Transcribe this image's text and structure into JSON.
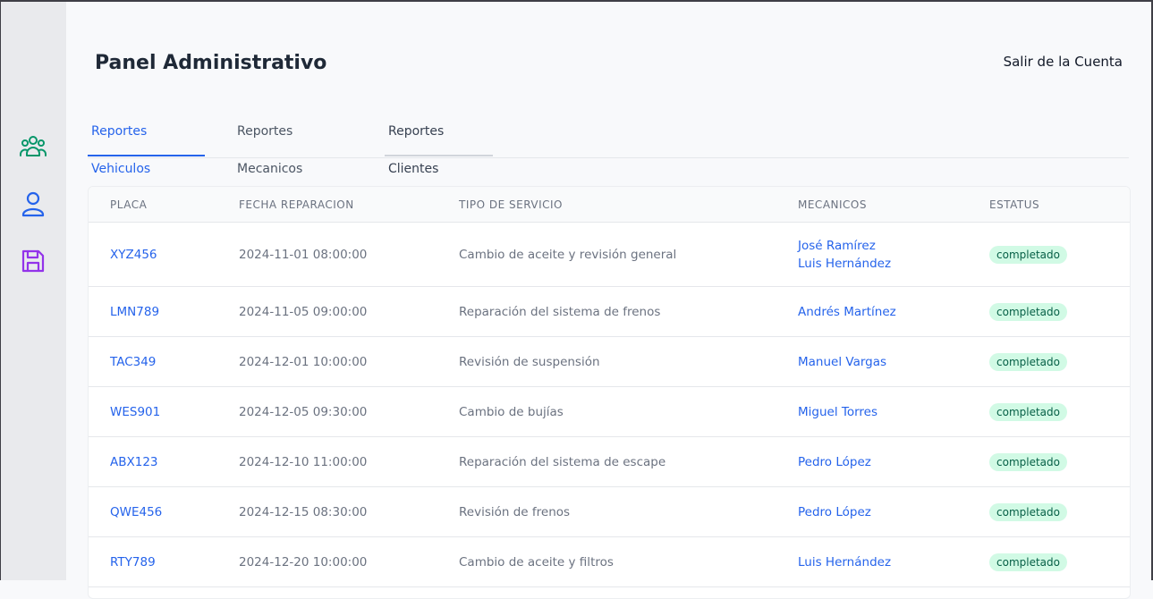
{
  "header": {
    "title": "Panel Administrativo",
    "logout_label": "Salir de la Cuenta"
  },
  "sidebar": {
    "icons": [
      "users-group-icon",
      "user-icon",
      "save-icon"
    ],
    "colors": {
      "users": "#059669",
      "user": "#2563eb",
      "save": "#9333ea"
    }
  },
  "tabs": [
    {
      "label": "Reportes Vehiculos",
      "active": true
    },
    {
      "label": "Reportes Mecanicos",
      "active": false
    },
    {
      "label": "Reportes Clientes",
      "active": false
    }
  ],
  "table": {
    "columns": [
      "PLACA",
      "FECHA REPARACION",
      "TIPO DE SERVICIO",
      "MECANICOS",
      "ESTATUS"
    ],
    "rows": [
      {
        "placa": "XYZ456",
        "fecha": "2024-11-01 08:00:00",
        "servicio": "Cambio de aceite y revisión general",
        "mecanicos": [
          "José Ramírez",
          "Luis Hernández"
        ],
        "estatus": "completado"
      },
      {
        "placa": "LMN789",
        "fecha": "2024-11-05 09:00:00",
        "servicio": "Reparación del sistema de frenos",
        "mecanicos": [
          "Andrés Martínez"
        ],
        "estatus": "completado"
      },
      {
        "placa": "TAC349",
        "fecha": "2024-12-01 10:00:00",
        "servicio": "Revisión de suspensión",
        "mecanicos": [
          "Manuel Vargas"
        ],
        "estatus": "completado"
      },
      {
        "placa": "WES901",
        "fecha": "2024-12-05 09:30:00",
        "servicio": "Cambio de bujías",
        "mecanicos": [
          "Miguel Torres"
        ],
        "estatus": "completado"
      },
      {
        "placa": "ABX123",
        "fecha": "2024-12-10 11:00:00",
        "servicio": "Reparación del sistema de escape",
        "mecanicos": [
          "Pedro López"
        ],
        "estatus": "completado"
      },
      {
        "placa": "QWE456",
        "fecha": "2024-12-15 08:30:00",
        "servicio": "Revisión de frenos",
        "mecanicos": [
          "Pedro López"
        ],
        "estatus": "completado"
      },
      {
        "placa": "RTY789",
        "fecha": "2024-12-20 10:00:00",
        "servicio": "Cambio de aceite y filtros",
        "mecanicos": [
          "Luis Hernández"
        ],
        "estatus": "completado"
      }
    ]
  }
}
